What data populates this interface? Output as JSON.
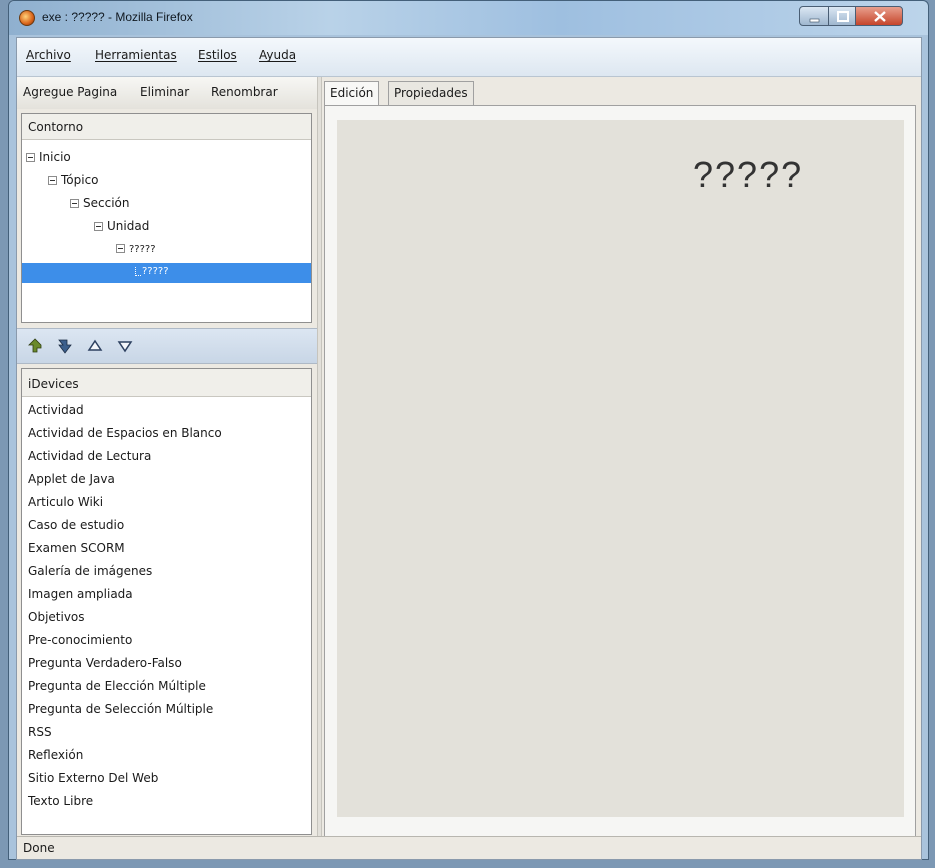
{
  "window": {
    "title": "exe : ????? - Mozilla Firefox"
  },
  "menu": {
    "items": [
      "Archivo",
      "Herramientas",
      "Estilos",
      "Ayuda"
    ]
  },
  "toolbar": {
    "add_page": "Agregue Pagina",
    "delete": "Eliminar",
    "rename": "Renombrar"
  },
  "outline": {
    "header": "Contorno",
    "nodes": [
      "Inicio",
      "Tópico",
      "Sección",
      "Unidad",
      "?????",
      "?????"
    ],
    "selected_index": 5
  },
  "nav_icons": [
    "promote-icon",
    "demote-icon",
    "move-up-icon",
    "move-down-icon"
  ],
  "idevices": {
    "header": "iDevices",
    "items": [
      "Actividad",
      "Actividad de Espacios en Blanco",
      "Actividad de Lectura",
      "Applet de Java",
      "Articulo Wiki",
      "Caso de estudio",
      "Examen SCORM",
      "Galería de imágenes",
      "Imagen ampliada",
      "Objetivos",
      "Pre-conocimiento",
      "Pregunta Verdadero-Falso",
      "Pregunta de Elección Múltiple",
      "Pregunta de Selección Múltiple",
      "RSS",
      "Reflexión",
      "Sitio Externo Del Web",
      "Texto Libre"
    ]
  },
  "tabs": [
    "Edición",
    "Propiedades"
  ],
  "active_tab": "Edición",
  "content": {
    "heading": "?????"
  },
  "status": {
    "text": "Done"
  },
  "colors": {
    "selection": "#3d8ee9",
    "content_background": "#e3e1da"
  }
}
